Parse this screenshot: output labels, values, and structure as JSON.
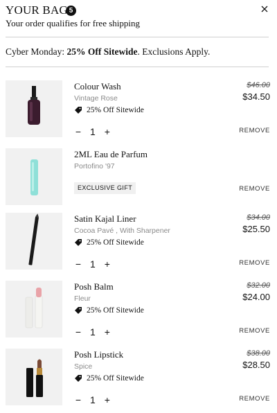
{
  "header": {
    "title": "YOUR BAG",
    "count": "5",
    "close_icon": "close-icon",
    "free_shipping": "Your order qualifies for free shipping"
  },
  "promo": {
    "prefix": "Cyber Monday: ",
    "highlight": "25% Off Sitewide",
    "suffix": ". Exclusions Apply."
  },
  "items": [
    {
      "name": "Colour Wash",
      "variant": "Vintage Rose",
      "promo": "25% Off Sitewide",
      "old_price": "$46.00",
      "price": "$34.50",
      "qty": "1",
      "minus": "−",
      "plus": "+",
      "remove": "REMOVE",
      "image": "nail-polish-bottle"
    },
    {
      "name": "2ML Eau de Parfum",
      "variant": "Portofino '97",
      "badge": "EXCLUSIVE GIFT",
      "remove": "REMOVE",
      "image": "perfume-vial"
    },
    {
      "name": "Satin Kajal Liner",
      "variant": "Cocoa Pavé , With Sharpener",
      "promo": "25% Off Sitewide",
      "old_price": "$34.00",
      "price": "$25.50",
      "qty": "1",
      "minus": "−",
      "plus": "+",
      "remove": "REMOVE",
      "image": "eyeliner-pencil"
    },
    {
      "name": "Posh Balm",
      "variant": "Fleur",
      "promo": "25% Off Sitewide",
      "old_price": "$32.00",
      "price": "$24.00",
      "qty": "1",
      "minus": "−",
      "plus": "+",
      "remove": "REMOVE",
      "image": "lip-balm-tube"
    },
    {
      "name": "Posh Lipstick",
      "variant": "Spice",
      "promo": "25% Off Sitewide",
      "old_price": "$38.00",
      "price": "$28.50",
      "qty": "1",
      "minus": "−",
      "plus": "+",
      "remove": "REMOVE",
      "image": "lipstick-tube"
    }
  ],
  "colors": {
    "text": "#111111",
    "muted": "#8a8a8a",
    "divider": "#cfcfcf",
    "thumb_bg": "#f1f1f1",
    "badge_bg": "#f0f0f0"
  }
}
